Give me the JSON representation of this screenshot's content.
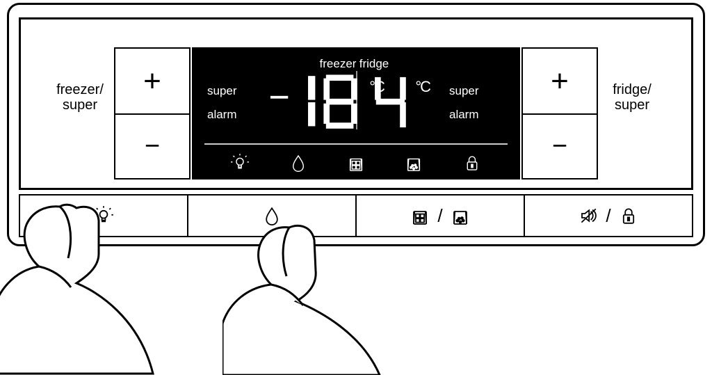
{
  "labels": {
    "left_side_line1": "freezer/",
    "left_side_line2": "super",
    "right_side_line1": "fridge/",
    "right_side_line2": "super",
    "plus": "+",
    "minus": "−"
  },
  "lcd": {
    "freezer_title": "freezer",
    "fridge_title": "fridge",
    "flag_super": "super",
    "flag_alarm": "alarm",
    "freezer_temp_sign": "−",
    "freezer_temp_value": "18",
    "fridge_temp_value": "4",
    "unit": "°C",
    "icons": [
      "light",
      "water",
      "ice-cubes",
      "crushed-ice",
      "lock"
    ]
  },
  "buttons": [
    {
      "id": "light",
      "icons": [
        "light"
      ]
    },
    {
      "id": "water",
      "icons": [
        "water"
      ]
    },
    {
      "id": "ice",
      "icons": [
        "ice-cubes",
        "crushed-ice"
      ],
      "separator": "/"
    },
    {
      "id": "mute-lock",
      "icons": [
        "mute",
        "lock"
      ],
      "separator": "/"
    }
  ]
}
